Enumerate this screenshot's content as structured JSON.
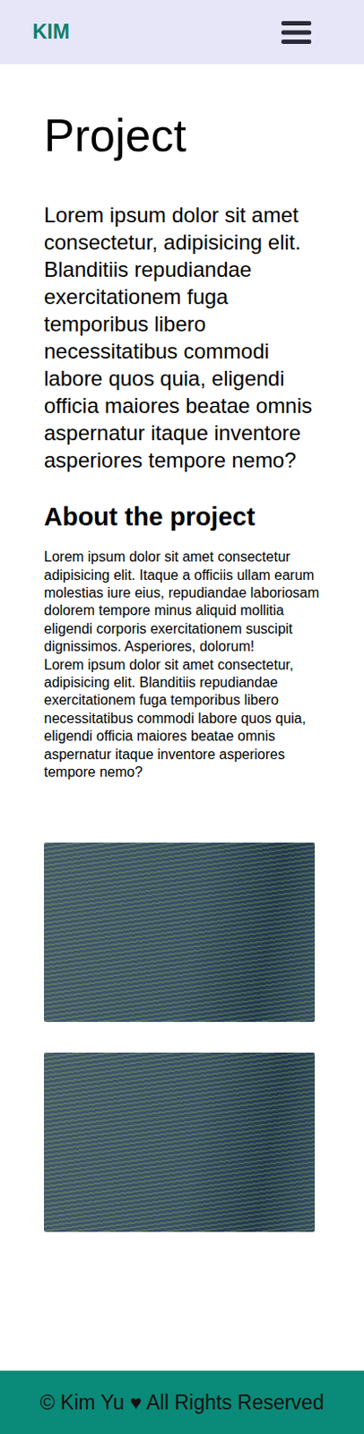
{
  "header": {
    "logo": "KIM"
  },
  "page": {
    "title": "Project",
    "intro": "Lorem ipsum dolor sit amet consectetur, adipisicing elit. Blanditiis repudiandae exercitationem fuga temporibus libero necessitatibus commodi labore quos quia, eligendi officia maiores beatae omnis aspernatur itaque inventore asperiores tempore nemo?",
    "section_title": "About the project",
    "paragraphs": [
      "Lorem ipsum dolor sit amet consectetur adipisicing elit. Itaque a officiis ullam earum molestias iure eius, repudiandae laboriosam dolorem tempore minus aliquid mollitia eligendi corporis exercitationem suscipit dignissimos. Asperiores, dolorum!",
      "Lorem ipsum dolor sit amet consectetur, adipisicing elit. Blanditiis repudiandae exercitationem fuga temporibus libero necessitatibus commodi labore quos quia, eligendi officia maiores beatae omnis aspernatur itaque inventore asperiores tempore nemo?"
    ]
  },
  "footer": {
    "text": "© Kim Yu ♥ All Rights Reserved"
  }
}
